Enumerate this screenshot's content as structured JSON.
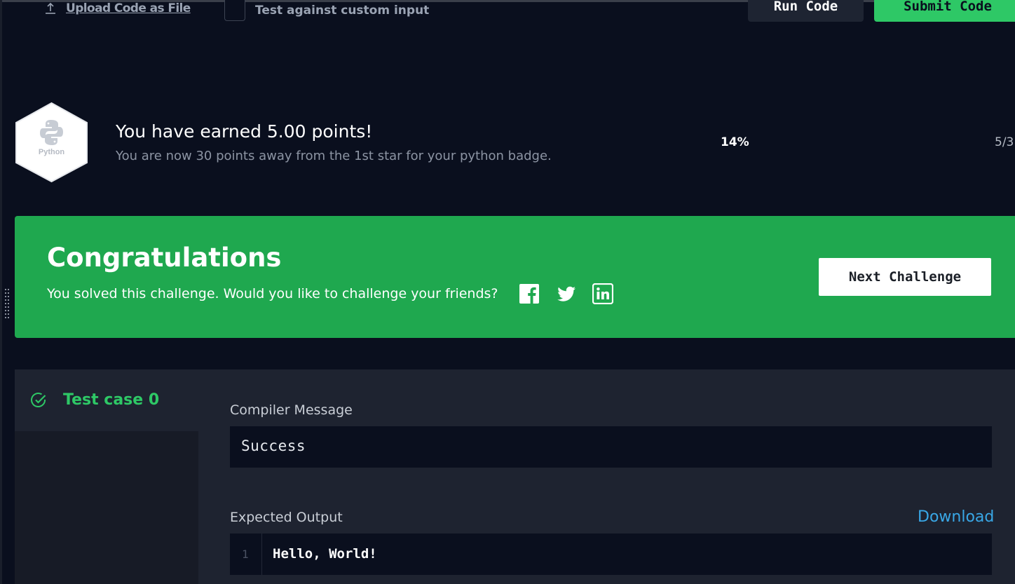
{
  "toolbar": {
    "upload_label": "Upload Code as File",
    "custom_input_label": "Test against custom input",
    "run_label": "Run Code",
    "submit_label": "Submit Code"
  },
  "points": {
    "badge_label": "Python",
    "title": "You have earned 5.00 points!",
    "subtitle": "You are now 30 points away from the 1st star for your python badge.",
    "percent": "14%",
    "progress": 0.14,
    "count": "5/3"
  },
  "congrats": {
    "title": "Congratulations",
    "message": "You solved this challenge. Would you like to challenge your friends?",
    "next_label": "Next Challenge",
    "social_icons": [
      "facebook-icon",
      "twitter-icon",
      "linkedin-icon"
    ]
  },
  "results": {
    "testcase_label": "Test case 0",
    "compiler_label": "Compiler Message",
    "compiler_message": "Success",
    "expected_label": "Expected Output",
    "download_label": "Download",
    "expected_line_number": "1",
    "expected_output": "Hello, World!"
  },
  "colors": {
    "background": "#0a0f1e",
    "success_green": "#2ec866",
    "banner_green": "#1fa84f",
    "link_blue": "#39a7e6"
  }
}
